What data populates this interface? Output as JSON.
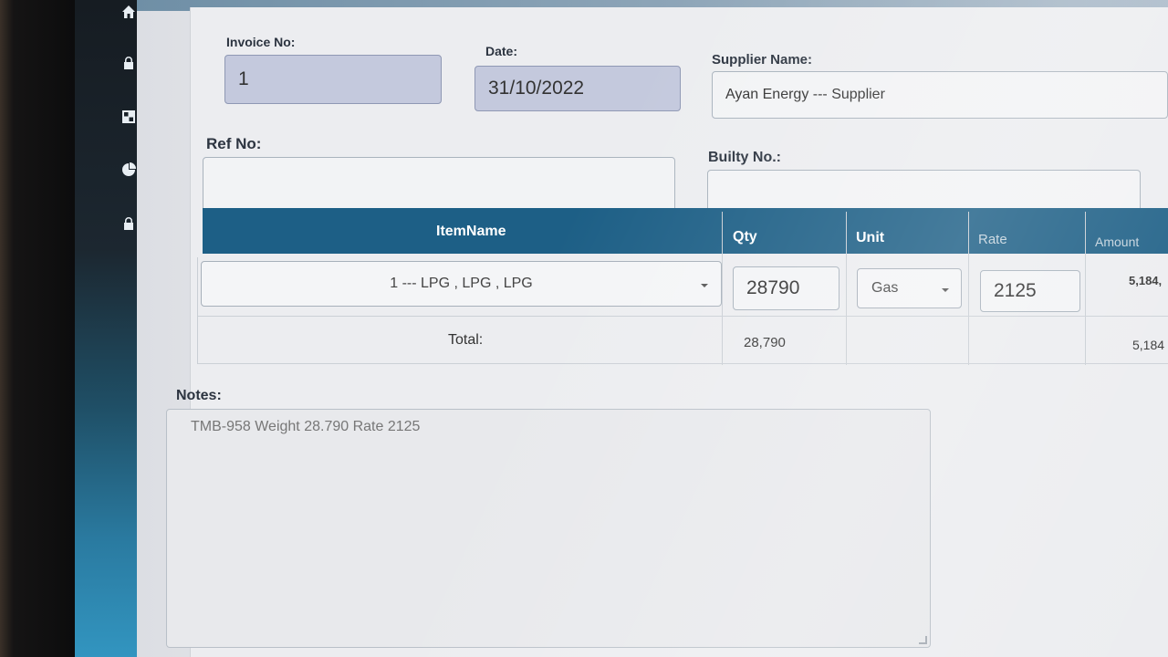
{
  "sidebar": {
    "icons": [
      {
        "name": "home-icon"
      },
      {
        "name": "lock-icon"
      },
      {
        "name": "grid-icon"
      },
      {
        "name": "pie-chart-icon"
      },
      {
        "name": "lock-icon"
      }
    ]
  },
  "form": {
    "invoice_no_label": "Invoice No:",
    "invoice_no_value": "1",
    "date_label": "Date:",
    "date_value": "31/10/2022",
    "supplier_label": "Supplier Name:",
    "supplier_value": "Ayan Energy --- Supplier",
    "ref_label": "Ref No:",
    "ref_value": "",
    "builty_label": "Builty No.:",
    "builty_value": ""
  },
  "table": {
    "headers": [
      "ItemName",
      "Qty",
      "Unit",
      "Rate",
      "Amount"
    ],
    "row": {
      "item": "1 --- LPG , LPG , LPG",
      "qty": "28790",
      "unit": "Gas",
      "rate": "2125",
      "amount": "5,184,"
    },
    "total": {
      "label": "Total:",
      "qty": "28,790",
      "amount": "5,184"
    }
  },
  "notes": {
    "label": "Notes:",
    "value": "TMB-958 Weight 28.790 Rate 2125"
  }
}
